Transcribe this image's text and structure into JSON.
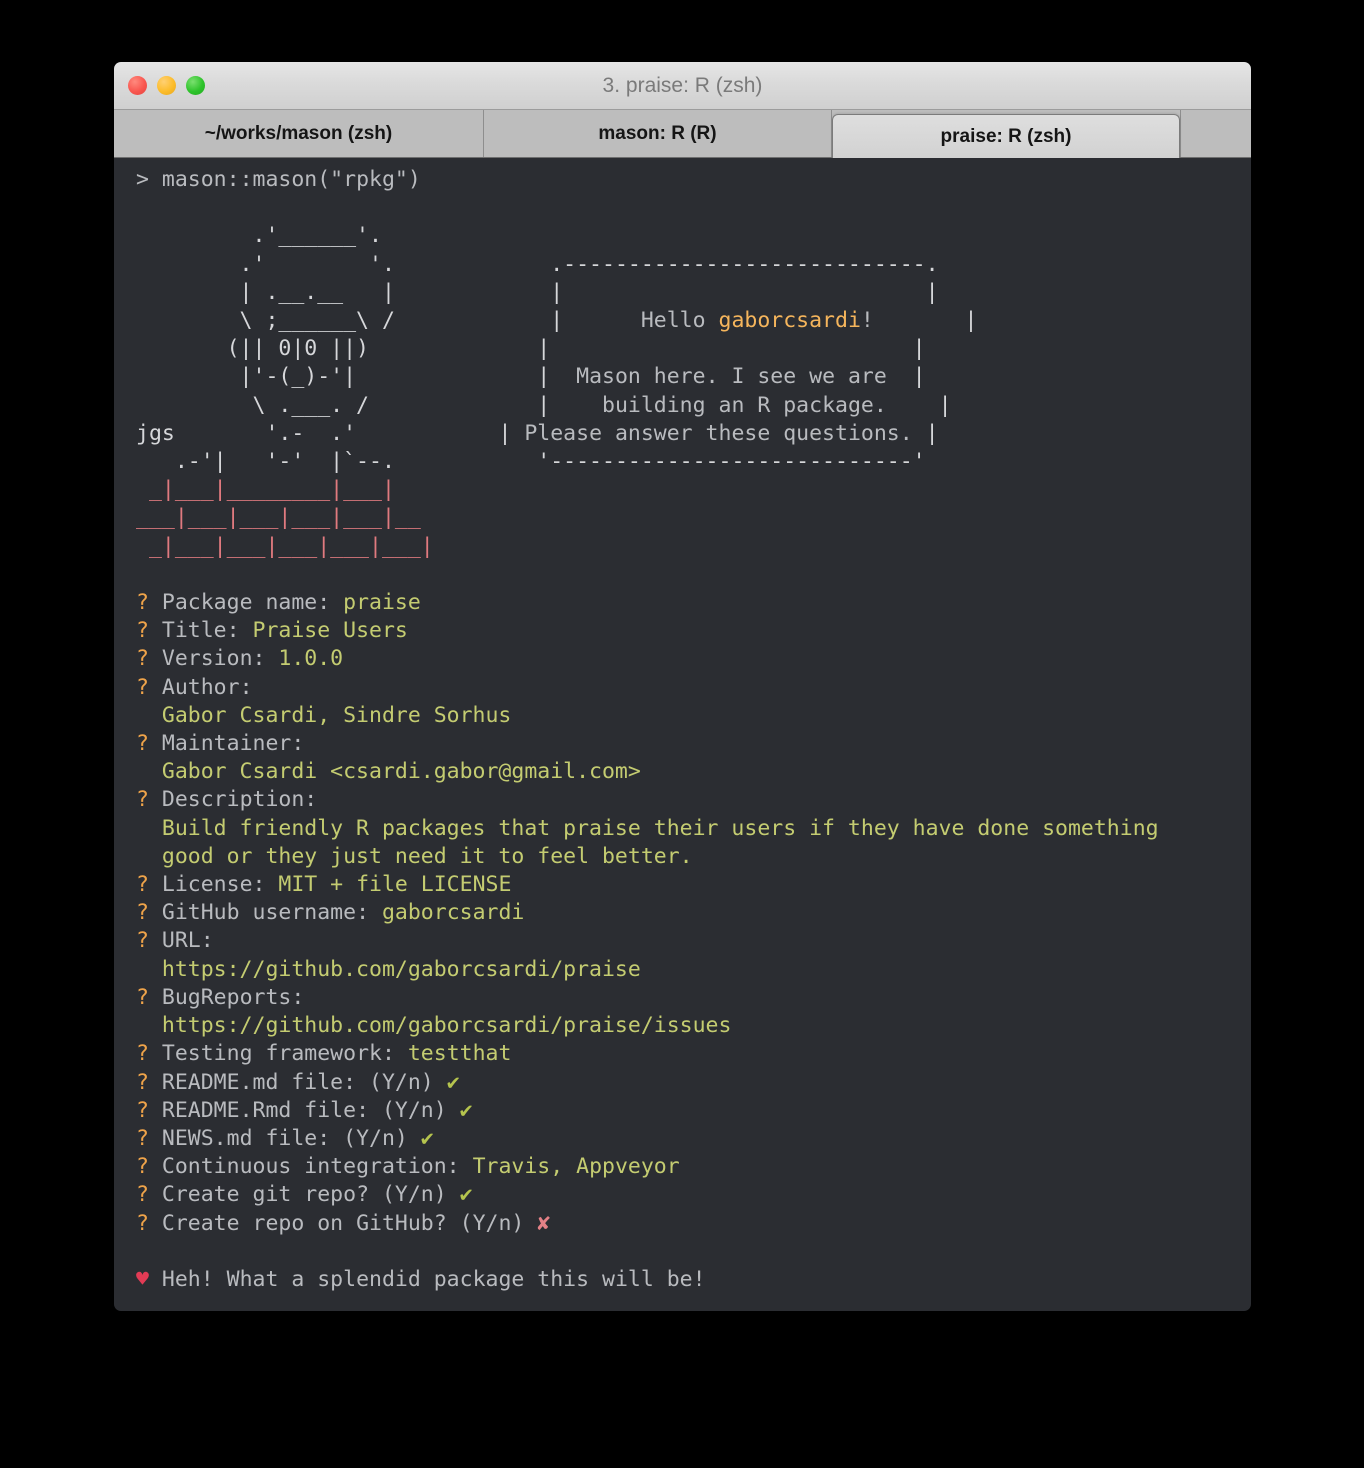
{
  "window": {
    "title": "3. praise: R (zsh)",
    "traffic_lights": [
      "close",
      "minimize",
      "maximize"
    ]
  },
  "tabs": [
    {
      "label": "~/works/mason (zsh)",
      "active": false
    },
    {
      "label": "mason: R (R)",
      "active": false
    },
    {
      "label": "praise: R (zsh)",
      "active": true
    }
  ],
  "colors": {
    "terminal_bg": "#2b2d32",
    "terminal_fg": "#d6d7da",
    "prompt_grey": "#b9bbbf",
    "question_yellow": "#f0a44a",
    "value_green": "#c9d07a",
    "brick_red": "#e07a7f",
    "heart_red": "#e23b55",
    "check_green": "#b5c44e",
    "cross_red": "#e48187",
    "titlebar_grey": "#dadada",
    "tabbar_grey": "#bdbdbd"
  },
  "terminal": {
    "prompt_symbol": ">",
    "command": "mason::mason(\"rpkg\")",
    "ascii_art": {
      "artist_signature": "jgs",
      "mason_lines": [
        "       .'______'.",
        "      .'        '.",
        "      | .__.__   |",
        "      \\ ;______\\ /",
        "     (|| 0|0 ||)",
        "      |'-(_)-'|",
        "       \\ .___. /",
        "         '.-  .'"
      ],
      "wall_lines": [
        "  .-'|   '-'  |`--.",
        "_|___|________|___|",
        "___|___|___|___|___|__",
        "_|___|___|___|___|___|"
      ]
    },
    "greeting_box": {
      "line1_prefix": "Hello ",
      "line1_user": "gaborcsardi",
      "line1_suffix": "!",
      "line2": "Mason here. I see we are",
      "line3": "building an R package.",
      "line4": "Please answer these questions."
    },
    "questions": [
      {
        "marker": "?",
        "label": "Package name: ",
        "value": "praise",
        "value_color": "green"
      },
      {
        "marker": "?",
        "label": "Title: ",
        "value": "Praise Users",
        "value_color": "green"
      },
      {
        "marker": "?",
        "label": "Version: ",
        "value": "1.0.0",
        "value_color": "green"
      },
      {
        "marker": "?",
        "label": "Author:",
        "value": "",
        "value_color": "green",
        "continuation": [
          "Gabor Csardi, Sindre Sorhus"
        ]
      },
      {
        "marker": "?",
        "label": "Maintainer:",
        "value": "",
        "value_color": "green",
        "continuation": [
          "Gabor Csardi <csardi.gabor@gmail.com>"
        ]
      },
      {
        "marker": "?",
        "label": "Description:",
        "value": "",
        "value_color": "green",
        "continuation": [
          "Build friendly R packages that praise their users if they have done something",
          "good or they just need it to feel better."
        ]
      },
      {
        "marker": "?",
        "label": "License: ",
        "value": "MIT + file LICENSE",
        "value_color": "green"
      },
      {
        "marker": "?",
        "label": "GitHub username: ",
        "value": "gaborcsardi",
        "value_color": "green"
      },
      {
        "marker": "?",
        "label": "URL:",
        "value": "",
        "value_color": "green",
        "continuation": [
          "https://github.com/gaborcsardi/praise"
        ]
      },
      {
        "marker": "?",
        "label": "BugReports:",
        "value": "",
        "value_color": "green",
        "continuation": [
          "https://github.com/gaborcsardi/praise/issues"
        ]
      },
      {
        "marker": "?",
        "label": "Testing framework: ",
        "value": "testthat",
        "value_color": "green"
      },
      {
        "marker": "?",
        "label": "README.md file: (Y/n) ",
        "value": "✔",
        "value_color": "check"
      },
      {
        "marker": "?",
        "label": "README.Rmd file: (Y/n) ",
        "value": "✔",
        "value_color": "check"
      },
      {
        "marker": "?",
        "label": "NEWS.md file: (Y/n) ",
        "value": "✔",
        "value_color": "check"
      },
      {
        "marker": "?",
        "label": "Continuous integration: ",
        "value": "Travis, Appveyor",
        "value_color": "green"
      },
      {
        "marker": "?",
        "label": "Create git repo? (Y/n) ",
        "value": "✔",
        "value_color": "check"
      },
      {
        "marker": "?",
        "label": "Create repo on GitHub? (Y/n) ",
        "value": "✘",
        "value_color": "cross"
      }
    ],
    "praise_line": {
      "heart": "♥",
      "text": "Heh! What a splendid package this will be!"
    },
    "final_prompt": ">"
  }
}
